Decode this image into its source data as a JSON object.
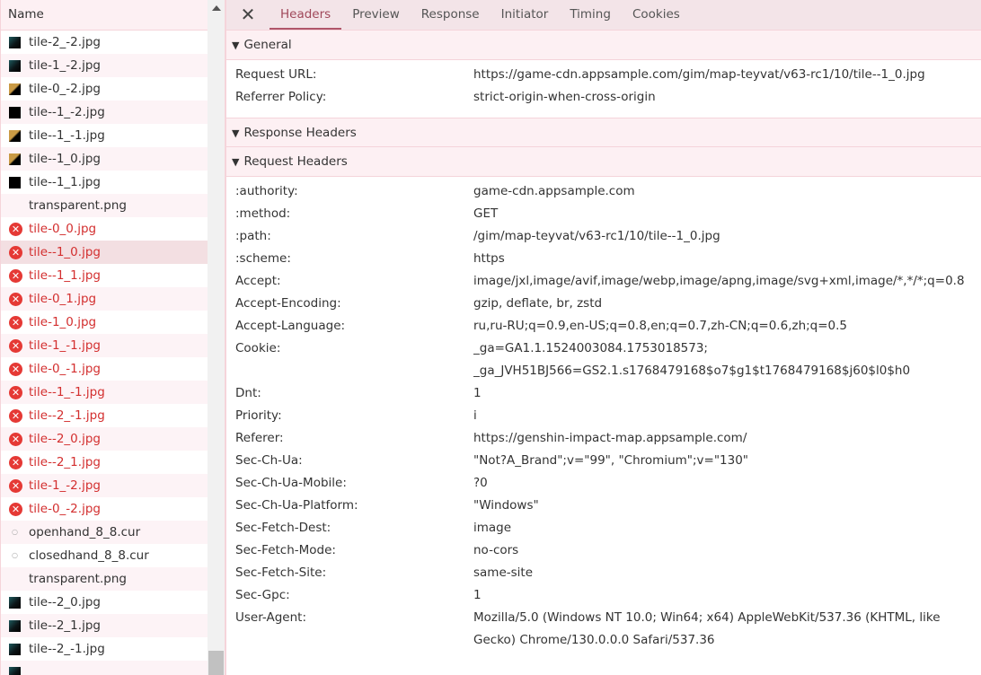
{
  "list": {
    "header": "Name",
    "items": [
      {
        "name": "tile-2_-2.jpg",
        "kind": "thumb"
      },
      {
        "name": "tile-1_-2.jpg",
        "kind": "thumb"
      },
      {
        "name": "tile-0_-2.jpg",
        "kind": "gold"
      },
      {
        "name": "tile--1_-2.jpg",
        "kind": "dark"
      },
      {
        "name": "tile--1_-1.jpg",
        "kind": "gold"
      },
      {
        "name": "tile--1_0.jpg",
        "kind": "gold"
      },
      {
        "name": "tile--1_1.jpg",
        "kind": "dark"
      },
      {
        "name": "transparent.png",
        "kind": "none"
      },
      {
        "name": "tile-0_0.jpg",
        "kind": "error"
      },
      {
        "name": "tile--1_0.jpg",
        "kind": "error",
        "selected": true
      },
      {
        "name": "tile--1_1.jpg",
        "kind": "error"
      },
      {
        "name": "tile-0_1.jpg",
        "kind": "error"
      },
      {
        "name": "tile-1_0.jpg",
        "kind": "error"
      },
      {
        "name": "tile-1_-1.jpg",
        "kind": "error"
      },
      {
        "name": "tile-0_-1.jpg",
        "kind": "error"
      },
      {
        "name": "tile--1_-1.jpg",
        "kind": "error"
      },
      {
        "name": "tile--2_-1.jpg",
        "kind": "error"
      },
      {
        "name": "tile--2_0.jpg",
        "kind": "error"
      },
      {
        "name": "tile--2_1.jpg",
        "kind": "error"
      },
      {
        "name": "tile-1_-2.jpg",
        "kind": "error"
      },
      {
        "name": "tile-0_-2.jpg",
        "kind": "error"
      },
      {
        "name": "openhand_8_8.cur",
        "kind": "cursor"
      },
      {
        "name": "closedhand_8_8.cur",
        "kind": "cursor"
      },
      {
        "name": "transparent.png",
        "kind": "none"
      },
      {
        "name": "tile--2_0.jpg",
        "kind": "thumb"
      },
      {
        "name": "tile--2_1.jpg",
        "kind": "thumb"
      },
      {
        "name": "tile--2_-1.jpg",
        "kind": "thumb"
      },
      {
        "name": "",
        "kind": "thumb"
      }
    ]
  },
  "tabs": {
    "close_icon": "close-icon",
    "items": [
      "Headers",
      "Preview",
      "Response",
      "Initiator",
      "Timing",
      "Cookies"
    ],
    "active": "Headers"
  },
  "general": {
    "title": "General",
    "rows": [
      {
        "k": "Request URL:",
        "v": "https://game-cdn.appsample.com/gim/map-teyvat/v63-rc1/10/tile--1_0.jpg"
      },
      {
        "k": "Referrer Policy:",
        "v": "strict-origin-when-cross-origin"
      }
    ]
  },
  "response_headers": {
    "title": "Response Headers"
  },
  "request_headers": {
    "title": "Request Headers",
    "rows": [
      {
        "k": ":authority:",
        "v": "game-cdn.appsample.com"
      },
      {
        "k": ":method:",
        "v": "GET"
      },
      {
        "k": ":path:",
        "v": "/gim/map-teyvat/v63-rc1/10/tile--1_0.jpg"
      },
      {
        "k": ":scheme:",
        "v": "https"
      },
      {
        "k": "Accept:",
        "v": "image/jxl,image/avif,image/webp,image/apng,image/svg+xml,image/*,*/*;q=0.8"
      },
      {
        "k": "Accept-Encoding:",
        "v": "gzip, deflate, br, zstd"
      },
      {
        "k": "Accept-Language:",
        "v": "ru,ru-RU;q=0.9,en-US;q=0.8,en;q=0.7,zh-CN;q=0.6,zh;q=0.5"
      },
      {
        "k": "Cookie:",
        "v": "_ga=GA1.1.1524003084.1753018573;",
        "v2": "_ga_JVH51BJ566=GS2.1.s1768479168$o7$g1$t1768479168$j60$l0$h0"
      },
      {
        "k": "Dnt:",
        "v": "1"
      },
      {
        "k": "Priority:",
        "v": "i"
      },
      {
        "k": "Referer:",
        "v": "https://genshin-impact-map.appsample.com/"
      },
      {
        "k": "Sec-Ch-Ua:",
        "v": "\"Not?A_Brand\";v=\"99\", \"Chromium\";v=\"130\""
      },
      {
        "k": "Sec-Ch-Ua-Mobile:",
        "v": "?0"
      },
      {
        "k": "Sec-Ch-Ua-Platform:",
        "v": "\"Windows\""
      },
      {
        "k": "Sec-Fetch-Dest:",
        "v": "image"
      },
      {
        "k": "Sec-Fetch-Mode:",
        "v": "no-cors"
      },
      {
        "k": "Sec-Fetch-Site:",
        "v": "same-site"
      },
      {
        "k": "Sec-Gpc:",
        "v": "1"
      },
      {
        "k": "User-Agent:",
        "v": "Mozilla/5.0 (Windows NT 10.0; Win64; x64) AppleWebKit/537.36 (KHTML, like",
        "v2": "Gecko) Chrome/130.0.0.0 Safari/537.36"
      }
    ]
  }
}
